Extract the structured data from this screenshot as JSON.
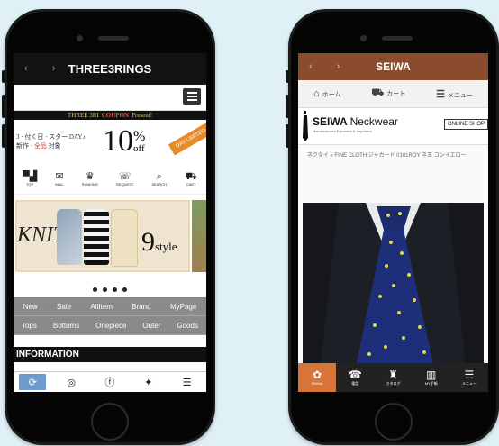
{
  "left_app": {
    "title": "THREE3RINGS",
    "nav_arrows": "‹  ›",
    "menu_icon": "menu-icon",
    "coupon": {
      "pre": "THREE 3RI",
      "highlight": "COUPON",
      "post": "Present!"
    },
    "banner": {
      "line1": "3 · 付く日 · スター DAY♪",
      "line2_pre": "新作 · ",
      "line2_red": "全品",
      "line2_post": " 対象",
      "number": "10",
      "pct": "%",
      "off": "off",
      "sash": "DAY LIMITED"
    },
    "icon_nav": [
      {
        "label": "TOP",
        "glyph": "▀▟",
        "icon": "shop-icon"
      },
      {
        "label": "MAIL",
        "glyph": "✉",
        "icon": "mail-icon"
      },
      {
        "label": "RANKING",
        "glyph": "♛",
        "icon": "crown-icon"
      },
      {
        "label": "REQUEST",
        "glyph": "☏",
        "icon": "request-icon"
      },
      {
        "label": "SEARCH",
        "glyph": "⌕",
        "icon": "search-icon"
      },
      {
        "label": "CART",
        "glyph": "⛟",
        "icon": "cart-icon"
      }
    ],
    "hero": {
      "word": "KNIT",
      "number": "9",
      "suffix": "style"
    },
    "dots": 4,
    "categories_row1": [
      "New",
      "Sale",
      "AllItem",
      "Brand",
      "MyPage"
    ],
    "categories_row2": [
      "Tops",
      "Bottoms",
      "Onepiece",
      "Outer",
      "Goods"
    ],
    "section_heading": "INFORMATION",
    "footer_icons": [
      {
        "glyph": "⟳",
        "icon": "share-icon",
        "active": true
      },
      {
        "glyph": "◎",
        "icon": "instagram-icon",
        "active": false
      },
      {
        "glyph": "ⓕ",
        "icon": "facebook-icon",
        "active": false
      },
      {
        "glyph": "✦",
        "icon": "twitter-icon",
        "active": false
      },
      {
        "glyph": "☰",
        "icon": "list-icon",
        "active": false
      }
    ]
  },
  "right_app": {
    "title": "SEIWA",
    "nav_arrows": "‹  ›",
    "menu": [
      {
        "glyph": "⌂",
        "icon": "home-icon",
        "label": "ホーム"
      },
      {
        "glyph": "⛟",
        "icon": "cart-icon",
        "label": "カート"
      },
      {
        "glyph": "☰",
        "icon": "menu-icon",
        "label": "メニュー"
      }
    ],
    "brand": {
      "name": "SEIWA",
      "name2": "Neckwear",
      "subtitle": "Manufacturers,Exporters & Importers",
      "shop_button": "ONLINE SHOP"
    },
    "breadcrumb": "ネクタイ » FINE CLOTH ジャカード 0101ROY ネ玉 コンイエロー",
    "photo_alt": "navy polka dot tie",
    "footer": [
      {
        "glyph": "✿",
        "icon": "seiwa-icon",
        "label": "SEIWA",
        "active": true
      },
      {
        "glyph": "☎",
        "icon": "phone-icon",
        "label": "電話",
        "active": false
      },
      {
        "glyph": "♜",
        "icon": "catalog-icon",
        "label": "カタログ",
        "active": false
      },
      {
        "glyph": "▥",
        "icon": "book-icon",
        "label": "MY手帳",
        "active": false
      },
      {
        "glyph": "☰",
        "icon": "menu-icon",
        "label": "メニュー",
        "active": false
      }
    ]
  },
  "colors": {
    "background": "#dff0f6",
    "seiwa_brand": "#8b4b2d",
    "seiwa_active": "#d6743a",
    "info_active": "#6f9ccf"
  }
}
